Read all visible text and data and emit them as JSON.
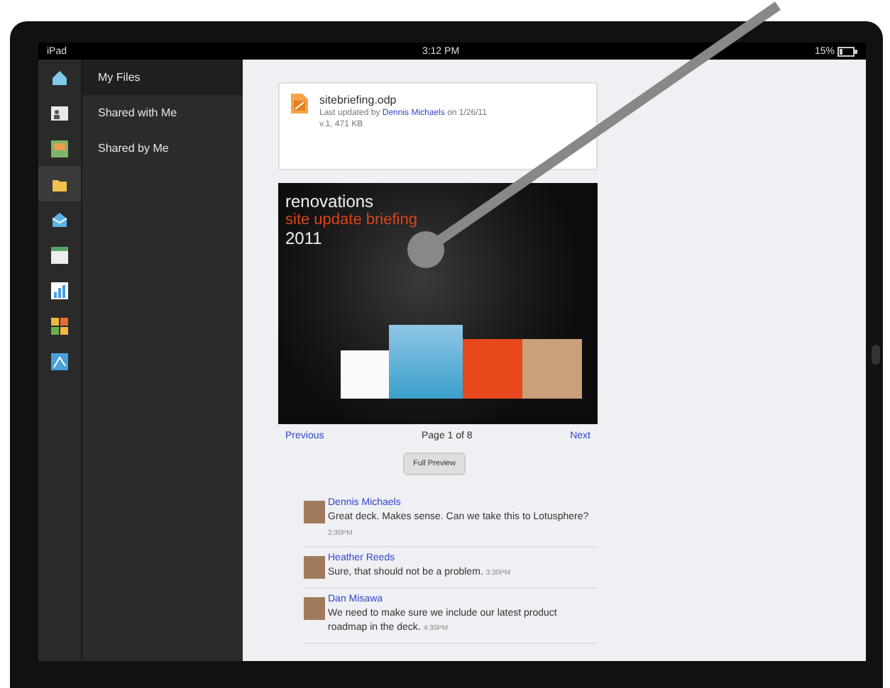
{
  "status_bar": {
    "carrier": "iPad",
    "time": "3:12 PM",
    "battery": "15%"
  },
  "app_icons": [
    {
      "kind": "home",
      "selected": false
    },
    {
      "kind": "contacts",
      "selected": false
    },
    {
      "kind": "photos",
      "selected": false
    },
    {
      "kind": "folder",
      "selected": true
    },
    {
      "kind": "mail",
      "selected": false
    },
    {
      "kind": "calendar",
      "selected": false
    },
    {
      "kind": "chart",
      "selected": false
    },
    {
      "kind": "grid",
      "selected": false
    },
    {
      "kind": "map",
      "selected": false
    }
  ],
  "menu": [
    {
      "label": "My Files",
      "selected": true
    },
    {
      "label": "Shared with Me",
      "selected": false
    },
    {
      "label": "Shared by Me",
      "selected": false
    }
  ],
  "file": {
    "name": "sitebriefing.odp",
    "updated_prefix": "Last updated by",
    "author": "Dennis Michaels",
    "updated_suffix": "on 1/26/11",
    "meta": "v.1, 471 KB"
  },
  "slide": {
    "title": "renovations",
    "subtitle": "site update briefing",
    "year": "2011"
  },
  "pager": {
    "previous": "Previous",
    "page": "Page 1 of 8",
    "next": "Next"
  },
  "full_preview_button": "Full Preview",
  "comments": [
    {
      "author": "Dennis Michaels",
      "text": "Great deck. Makes sense. Can we take this to Lotusphere?",
      "time": "2:30PM"
    },
    {
      "author": "Heather Reeds",
      "text": "Sure, that should not be a problem.",
      "time": "3:30PM"
    },
    {
      "author": "Dan Misawa",
      "text": "We need to make sure we include our latest product roadmap in the deck.",
      "time": "4:30PM"
    }
  ]
}
